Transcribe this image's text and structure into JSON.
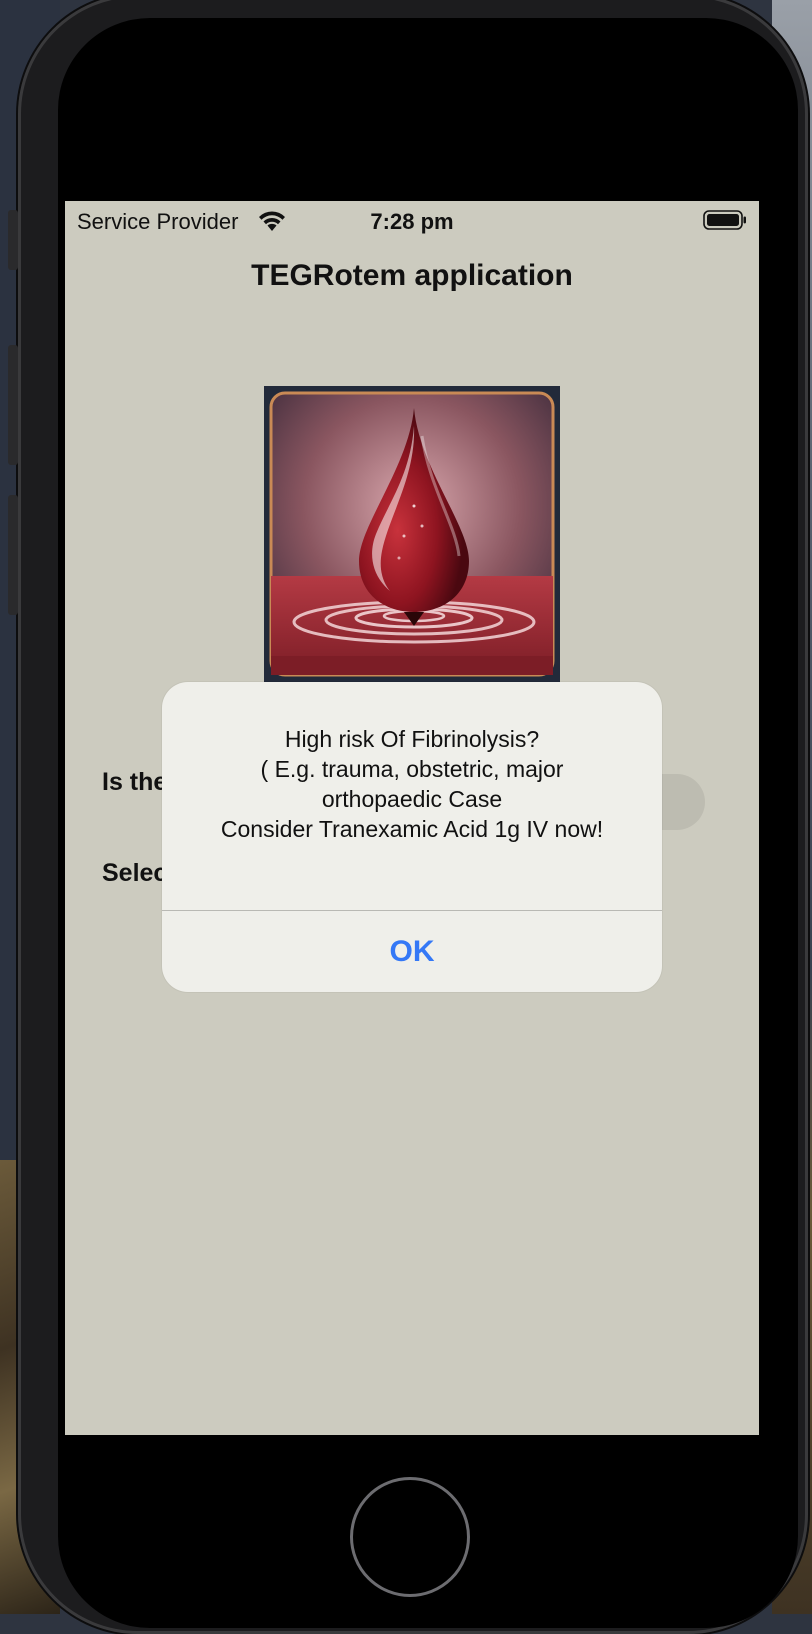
{
  "status_bar": {
    "carrier": "Service Provider",
    "time": "7:28 pm",
    "wifi_icon": "wifi-icon",
    "battery_icon": "battery-icon"
  },
  "app": {
    "title": "TEGRotem application",
    "image_icon": "blood-drop-image"
  },
  "form": {
    "row1_label": "Is the",
    "row2_label": "Selec"
  },
  "alert": {
    "message": "High risk Of Fibrinolysis?\n( E.g. trauma, obstetric, major\northopaedic Case\nConsider Tranexamic Acid 1g IV now!",
    "ok_label": "OK"
  },
  "colors": {
    "screen_bg": "#cccbbf",
    "alert_bg": "#efefea",
    "accent": "#3478f6"
  }
}
